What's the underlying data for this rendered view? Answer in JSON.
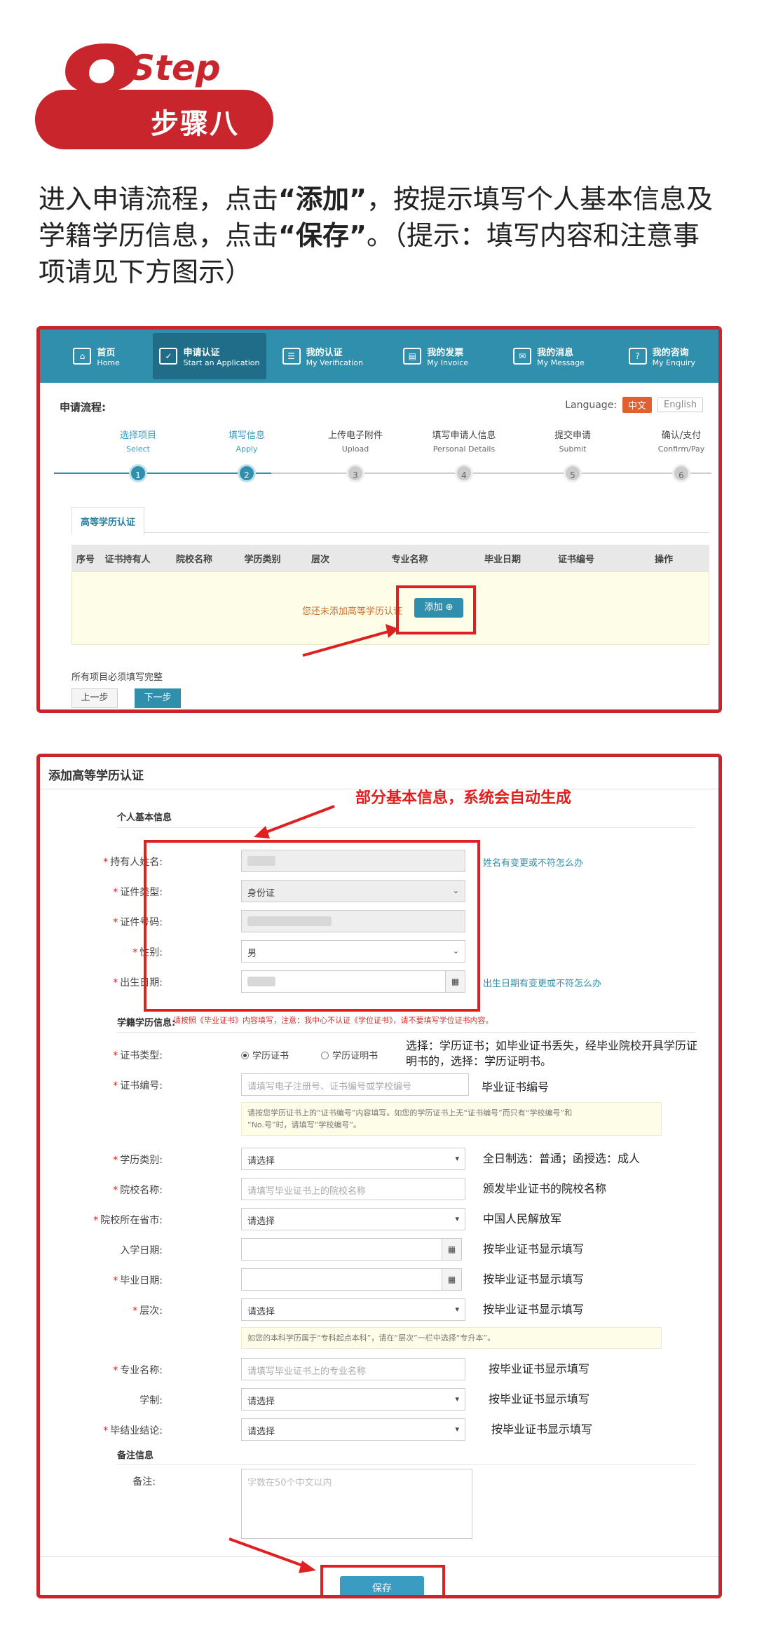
{
  "step": {
    "number": "8",
    "word": "Step",
    "title_cn": "步骤八"
  },
  "intro": {
    "p1": "进入申请流程，点击",
    "q1": "“添加”",
    "p2": "，按提示填写个人基本信息及学籍学历信息，点击",
    "q2": "“保存”",
    "p3": "。（提示：填写内容和注意事项请见下方图示）"
  },
  "nav": [
    {
      "cn": "首页",
      "en": "Home",
      "icon": "home-icon"
    },
    {
      "cn": "申请认证",
      "en": "Start an Application",
      "icon": "apply-icon",
      "active": true
    },
    {
      "cn": "我的认证",
      "en": "My Verification",
      "icon": "verification-icon"
    },
    {
      "cn": "我的发票",
      "en": "My Invoice",
      "icon": "invoice-icon"
    },
    {
      "cn": "我的消息",
      "en": "My Message",
      "icon": "message-icon"
    },
    {
      "cn": "我的咨询",
      "en": "My Enquiry",
      "icon": "enquiry-icon"
    }
  ],
  "flow": {
    "title": "申请流程:",
    "language_label": "Language:",
    "lang_cn": "中文",
    "lang_en": "English",
    "steps": [
      {
        "cn": "选择项目",
        "en": "Select",
        "num": "1",
        "done": true
      },
      {
        "cn": "填写信息",
        "en": "Apply",
        "num": "2",
        "done": true
      },
      {
        "cn": "上传电子附件",
        "en": "Upload",
        "num": "3"
      },
      {
        "cn": "填写申请人信息",
        "en": "Personal Details",
        "num": "4"
      },
      {
        "cn": "提交申请",
        "en": "Submit",
        "num": "5"
      },
      {
        "cn": "确认/支付",
        "en": "Confirm/Pay",
        "num": "6"
      }
    ],
    "tab": "高等学历认证",
    "columns": [
      "序号",
      "证书持有人",
      "院校名称",
      "学历类别",
      "层次",
      "专业名称",
      "毕业日期",
      "证书编号",
      "操作"
    ],
    "empty_msg": "您还未添加高等学历认证",
    "add_btn": "添加 ⊕",
    "note": "所有项目必须填写完整",
    "prev": "上一步",
    "next": "下一步"
  },
  "form": {
    "title": "添加高等学历认证",
    "annotation": "部分基本信息，系统会自动生成",
    "sec_personal": "个人基本信息",
    "holder_label": "持有人姓名:",
    "idtype_label": "证件类型:",
    "idtype_value": "身份证",
    "idno_label": "证件号码:",
    "gender_label": "性别:",
    "gender_value": "男",
    "birth_label": "出生日期:",
    "name_link": "姓名有变更或不符怎么办",
    "birth_link": "出生日期有变更或不符怎么办",
    "sec_edu": "学籍学历信息:",
    "edu_warn": "请按照《毕业证书》内容填写，注意：我中心不认证《学位证书》，请不要填写学位证书内容。",
    "certtype_label": "证书类型:",
    "cert_opt1": "学历证书",
    "cert_opt2": "学历证明书",
    "certtype_note1": "选择：学历证书；如毕业证书丢失，经毕业院校开具学历证",
    "certtype_note2": "明书的，选择：学历证明书。",
    "certno_label": "证书编号:",
    "certno_ph": "请填写电子注册号、证书编号或学校编号",
    "certno_note": "毕业证书编号",
    "certno_hint1": "请按您学历证书上的“证书编号”内容填写。如您的学历证书上无“证书编号”而只有“学校编号”和",
    "certno_hint2": "“No.号”时，请填写“学校编号”。",
    "edutype_label": "学历类别:",
    "select_ph": "请选择",
    "edutype_note": "全日制选：普通；函授选：成人",
    "school_label": "院校名称:",
    "school_ph": "请填写毕业证书上的院校名称",
    "school_note": "颁发毕业证书的院校名称",
    "province_label": "院校所在省市:",
    "province_note": "中国人民解放军",
    "enroll_label": "入学日期:",
    "enroll_note": "按毕业证书显示填写",
    "grad_label": "毕业日期:",
    "grad_note": "按毕业证书显示填写",
    "level_label": "层次:",
    "level_note": "按毕业证书显示填写",
    "level_hint": "如您的本科学历属于“专科起点本科”，请在“层次”一栏中选择“专升本”。",
    "major_label": "专业名称:",
    "major_ph": "请填写毕业证书上的专业名称",
    "major_note": "按毕业证书显示填写",
    "system_label": "学制:",
    "system_note": "按毕业证书显示填写",
    "conclusion_label": "毕结业结论:",
    "conclusion_note": "按毕业证书显示填写",
    "sec_remark": "备注信息",
    "remark_label": "备注:",
    "remark_ph": "字数在50个中文以内",
    "save": "保存"
  },
  "colors": {
    "brand_red": "#c8262c",
    "nav_blue": "#2f8fad",
    "highlight_red": "#e02020"
  }
}
